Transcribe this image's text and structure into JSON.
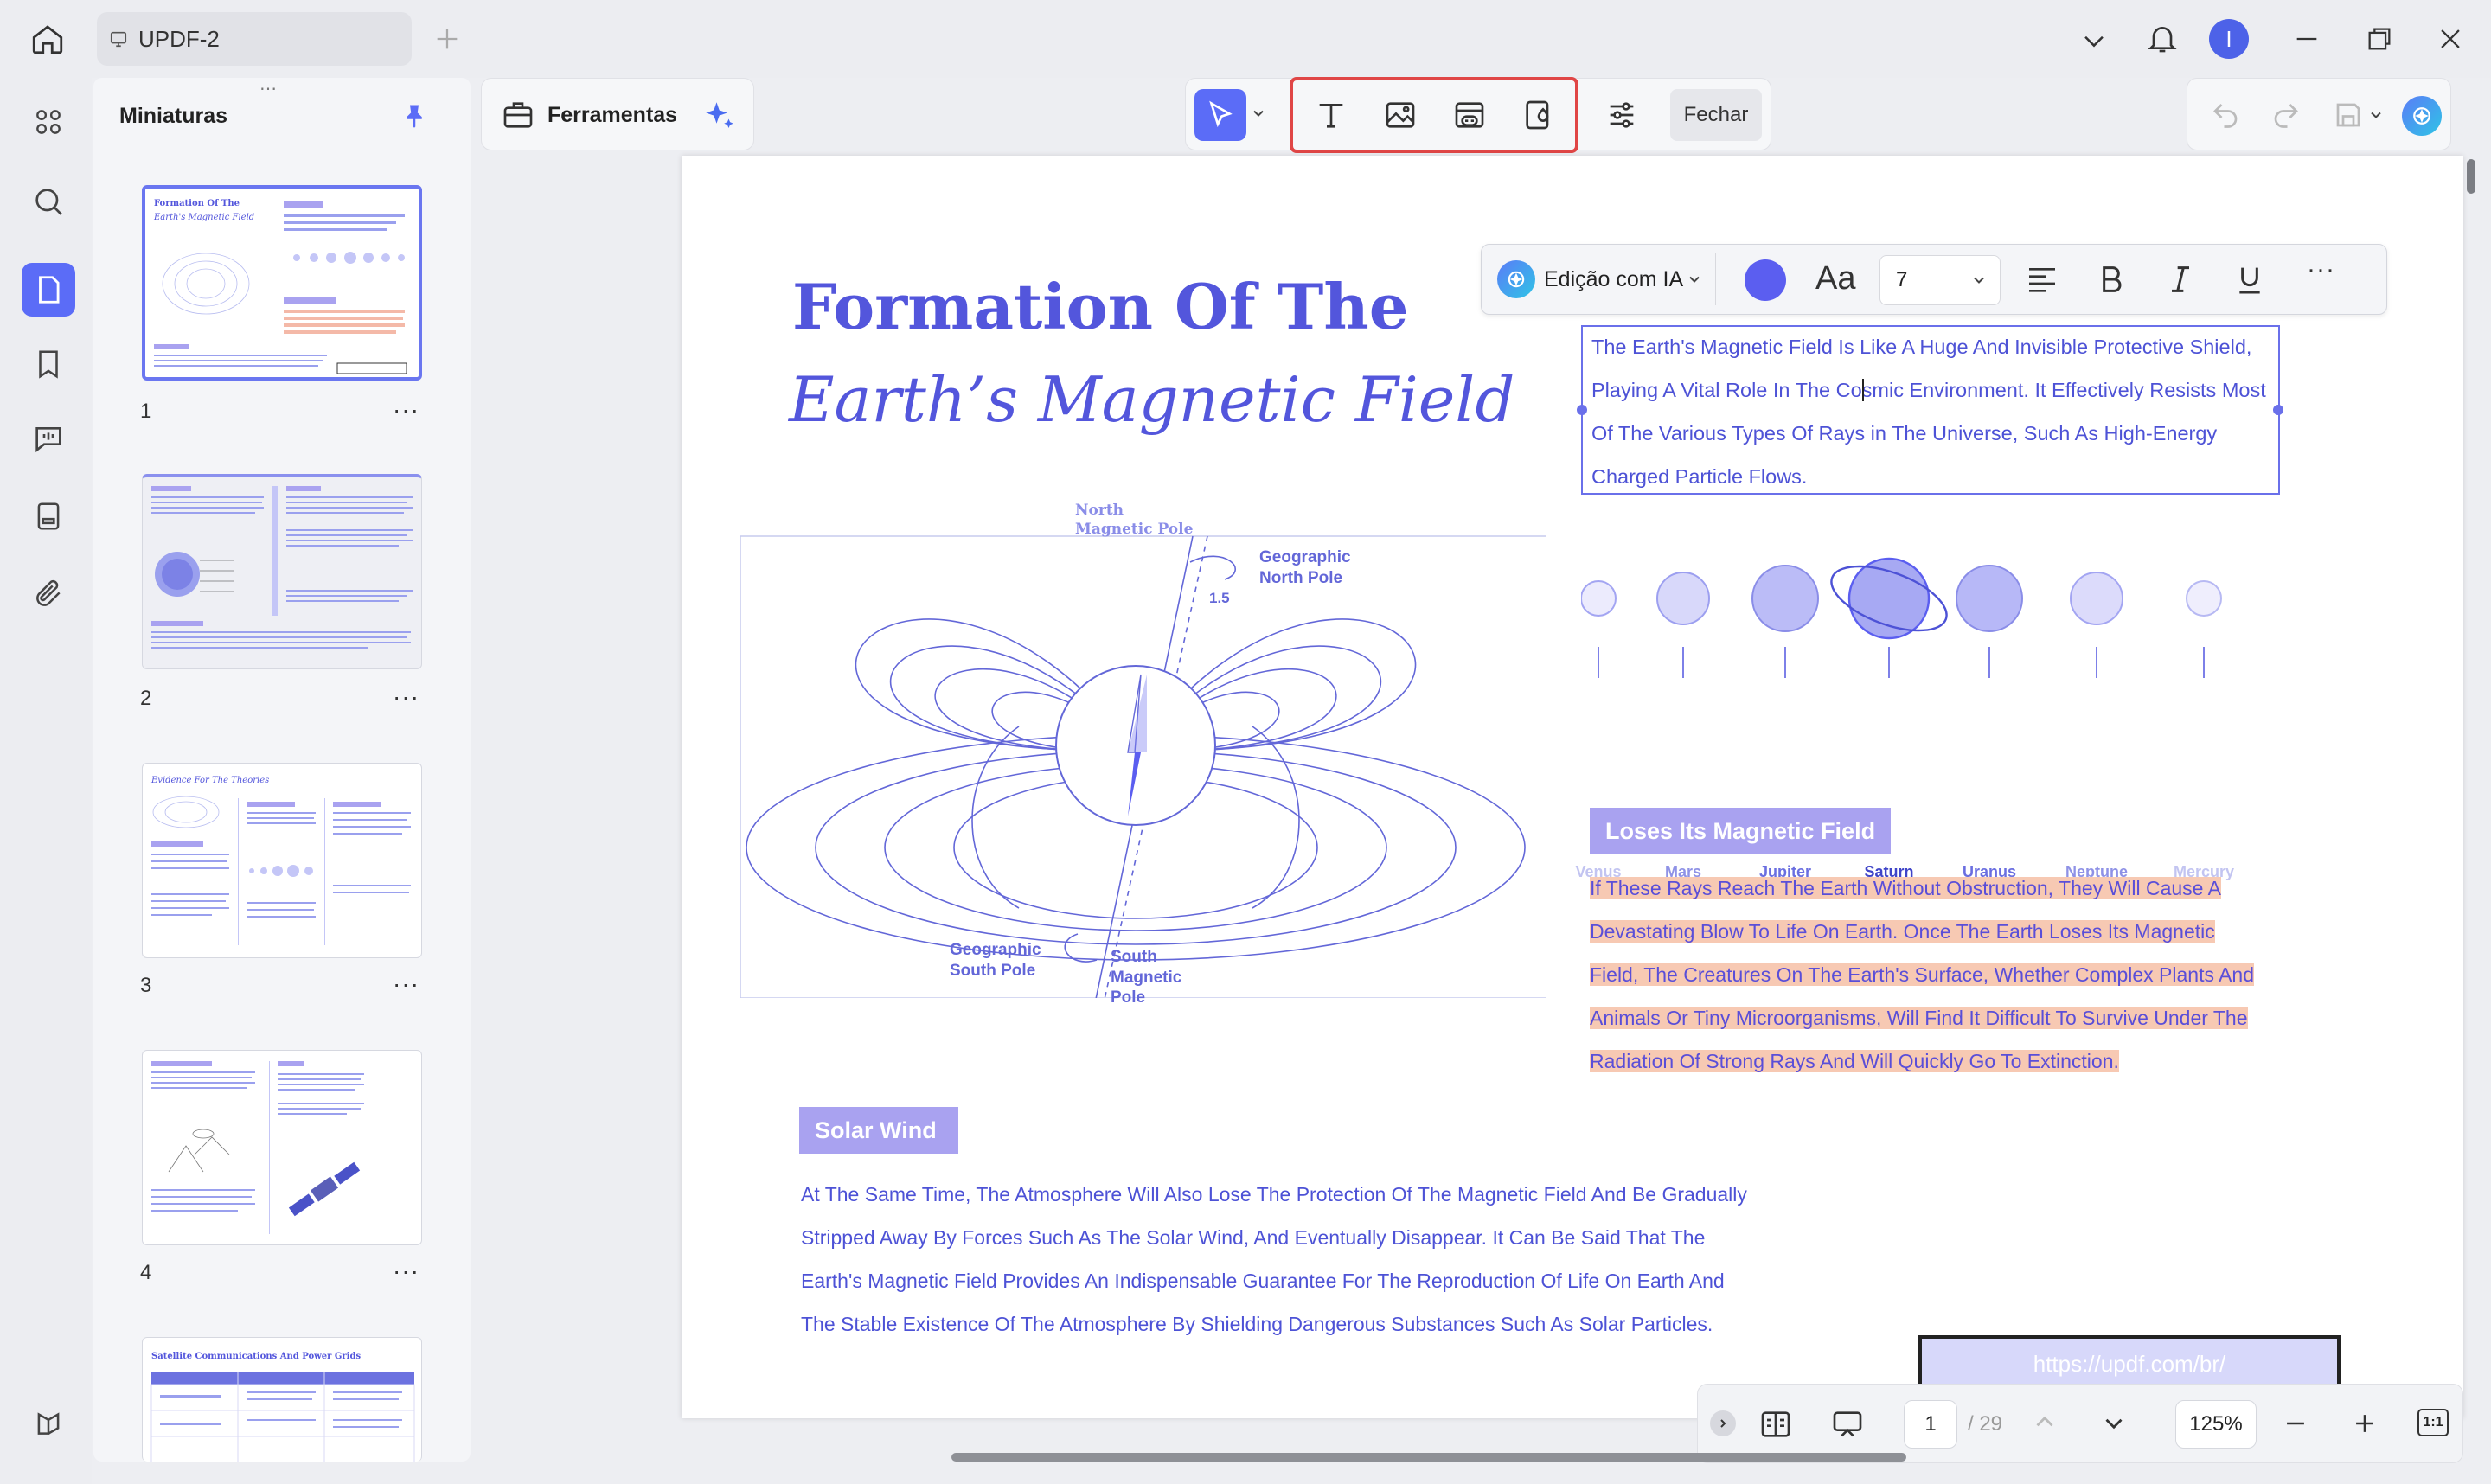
{
  "window": {
    "tab_title": "UPDF-2",
    "avatar_letter": "I"
  },
  "sidebar": {
    "panel_title": "Miniaturas",
    "pages": [
      {
        "number": "1",
        "more": "···"
      },
      {
        "number": "2",
        "more": "···"
      },
      {
        "number": "3",
        "more": "···"
      },
      {
        "number": "4",
        "more": "···"
      }
    ]
  },
  "toolbar": {
    "tools_label": "Ferramentas",
    "close_label": "Fechar"
  },
  "edit_toolbar": {
    "ai_label": "Edição com IA",
    "font_icon_text": "Aa",
    "font_size": "7",
    "more": "···",
    "text_color": "#5b5ef0"
  },
  "document": {
    "title_line1": "Formation Of The",
    "title_line2": "Earth’s Magnetic Field",
    "intro_lines": [
      "The Earth's Magnetic Field Is Like A Huge And Invisible Protective Shield,",
      "Playing A Vital Role In The Cosmic Environment. It Effectively Resists Most",
      "Of The Various Types Of Rays in The Universe, Such As High-Energy",
      "Charged Particle Flows."
    ],
    "diagram_labels": {
      "north_magnetic_1": "North",
      "north_magnetic_2": "Magnetic Pole",
      "geo_north_1": "Geographic",
      "geo_north_2": "North Pole",
      "angle": "1.5",
      "geo_south_1": "Geographic",
      "geo_south_2": "South Pole",
      "south_mag_1": "South",
      "south_mag_2": "Magnetic",
      "south_mag_3": "Pole"
    },
    "planets": [
      "Venus",
      "Mars",
      "Jupiter",
      "Saturn",
      "Uranus",
      "Neptune",
      "Mercury"
    ],
    "section1_heading": "Loses Its Magnetic Field",
    "section1_lines": [
      "If These Rays Reach The Earth Without Obstruction, They Will Cause A",
      "Devastating Blow To Life On Earth. Once The Earth Loses Its Magnetic",
      "Field, The Creatures On The Earth's Surface, Whether Complex Plants And",
      "Animals Or Tiny Microorganisms, Will Find It Difficult To Survive Under The",
      "Radiation Of Strong Rays And Will Quickly Go To Extinction."
    ],
    "section2_heading": "Solar Wind",
    "section2_lines": [
      "At The Same Time, The Atmosphere Will Also Lose The Protection Of The Magnetic Field And Be Gradually",
      "Stripped Away By Forces Such As The Solar Wind, And Eventually Disappear. It Can Be Said That The",
      "Earth's Magnetic Field Provides An Indispensable Guarantee For The Reproduction Of Life On Earth And",
      "The Stable Existence Of The Atmosphere By Shielding Dangerous Substances Such As Solar Particles."
    ],
    "watermark_url": "https://updf.com/br/"
  },
  "bottom_nav": {
    "current_page": "1",
    "total_pages": "/ 29",
    "zoom": "125%",
    "fit_label": "1:1"
  },
  "colors": {
    "accent": "#5b6cf7",
    "title": "#5356dc",
    "highlight_box": "#e04646"
  }
}
